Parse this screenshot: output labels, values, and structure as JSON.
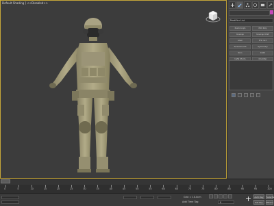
{
  "viewport": {
    "label": "Default Shading ] <<Disabled>>"
  },
  "command_panel": {
    "toolbar_icons": [
      "plus-icon",
      "modify-icon",
      "hierarchy-icon",
      "motion-icon",
      "display-icon",
      "utilities-icon"
    ],
    "modifier_list_label": "Modifier List",
    "modifier_buttons": [
      "Pushmorph",
      "Edit Poly",
      "Unwrap",
      "Unwrap UVW",
      "Shell",
      "FFD 3x3",
      "Turbosmooth",
      "Symmetry",
      "Skin",
      "Cloth",
      "UVW Xform",
      "Chamfer"
    ],
    "accent_color": "#c548b8"
  },
  "timeline": {
    "ticks": [
      "0",
      "5",
      "10",
      "15",
      "20",
      "25",
      "30",
      "35",
      "40",
      "45",
      "50",
      "55",
      "60",
      "65",
      "70",
      "75",
      "80",
      "85",
      "90",
      "95",
      "100"
    ]
  },
  "status_bar": {
    "grid_label": "Grid = 10.0cm",
    "add_time_tag": "Add Time Tag",
    "auto_key": "Auto Key",
    "set_key": "Set Key",
    "selected": "Selected",
    "filters": "Filters...",
    "frame_value": "0"
  }
}
